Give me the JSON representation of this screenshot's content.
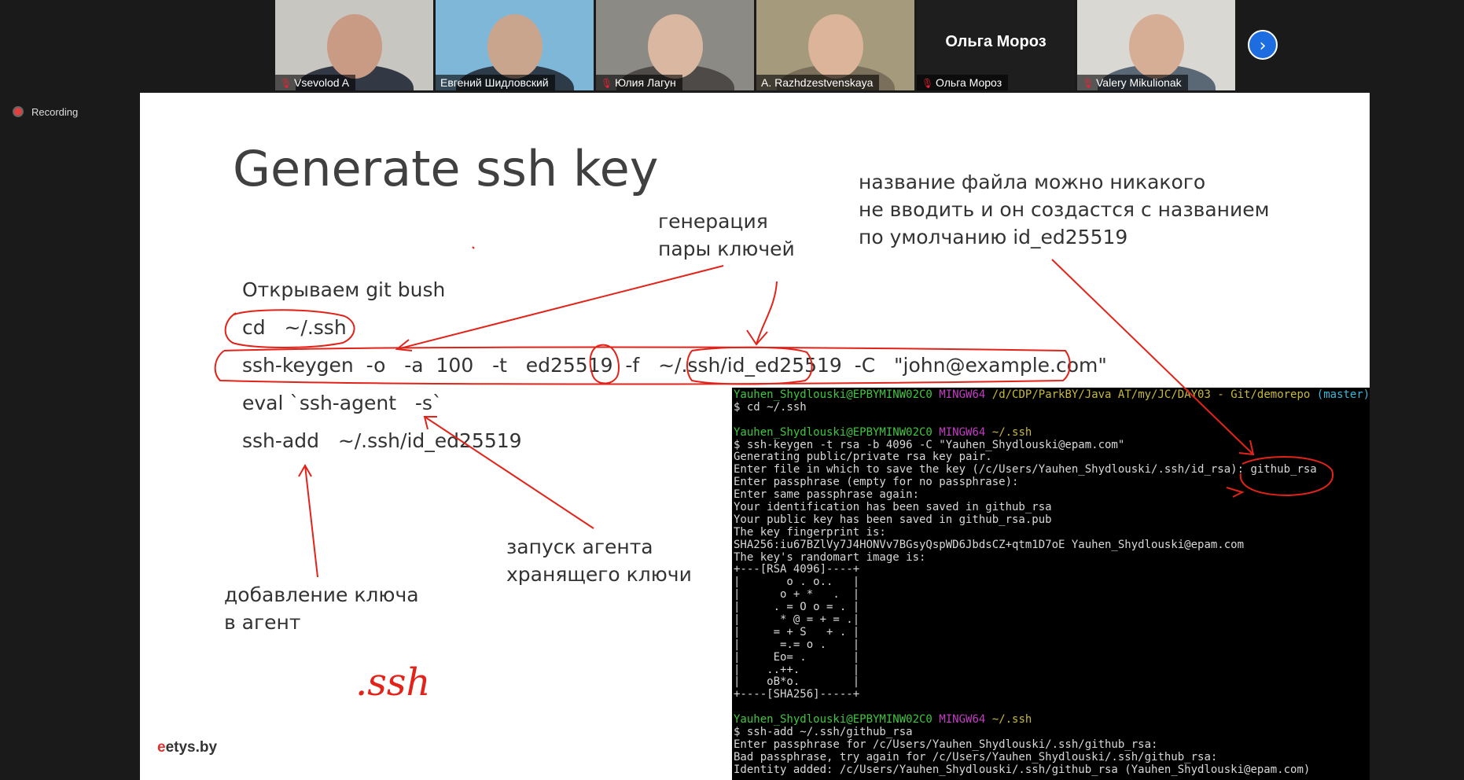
{
  "participants": [
    {
      "name": "Vsevolod A",
      "muted": true,
      "bg": "#c8c6c0",
      "skin": "#c99a84",
      "shirt": "#333944"
    },
    {
      "name": "Евгений Шидловский",
      "muted": false,
      "bg": "#7fb7d9",
      "skin": "#c9a58e",
      "shirt": "#2d3a48"
    },
    {
      "name": "Юлия Лагун",
      "muted": true,
      "bg": "#8c8a84",
      "skin": "#d9b7a0",
      "shirt": "#4d4a48"
    },
    {
      "name": "A. Razhdzestvenskaya",
      "muted": false,
      "bg": "#a69a7d",
      "skin": "#dbb49a",
      "shirt": "#7a6f5a"
    },
    {
      "name": "Ольга Мороз",
      "muted": true,
      "bg": "#1e1e1e"
    },
    {
      "name": "Valery Mikulionak",
      "muted": true,
      "bg": "#dad8d2",
      "skin": "#d6ad95",
      "shirt": "#5a6875"
    }
  ],
  "name_only_tile": "Ольга Мороз",
  "next_button": "›",
  "recording_label": "Recording",
  "slide": {
    "title": "Generate ssh key",
    "annotation_right": [
      "название файла можно никакого",
      "не вводить и он создастся с названием",
      "по умолчанию id_ed25519"
    ],
    "annotation_pair": [
      "генерация",
      "пары ключей"
    ],
    "open_gitbash": "Открываем git bush",
    "cmd_cd": "cd   ~/.ssh",
    "cmd_keygen": "ssh-keygen  -o   -a  100   -t   ed25519  -f   ~/.ssh/id_ed25519  -C   \"john@example.com\"",
    "cmd_eval": "eval `ssh-agent   -s`",
    "cmd_add": "ssh-add   ~/.ssh/id_ed25519",
    "annotation_agent": [
      "запуск агента",
      "хранящего ключи"
    ],
    "annotation_add": [
      "добавление ключа",
      "в агент"
    ],
    "handwritten": ".ssh",
    "logo_mark": "e",
    "logo_text": "etys.by"
  },
  "terminal": {
    "prompt_user": "Yauhen_Shydlouski@EPBYMINW02C0",
    "prompt_env": "MINGW64",
    "prompt_path1": "/d/CDP/ParkBY/Java AT/my/JC/DAY03 - Git/demorepo",
    "prompt_branch": "(master)",
    "prompt_path2": "~/.ssh",
    "lines_a": [
      "$ cd ~/.ssh"
    ],
    "lines_b": [
      "$ ssh-keygen -t rsa -b 4096 -C \"Yauhen_Shydlouski@epam.com\"",
      "Generating public/private rsa key pair.",
      "Enter file in which to save the key (/c/Users/Yauhen_Shydlouski/.ssh/id_rsa): github_rsa",
      "Enter passphrase (empty for no passphrase):",
      "Enter same passphrase again:",
      "Your identification has been saved in github_rsa",
      "Your public key has been saved in github_rsa.pub",
      "The key fingerprint is:",
      "SHA256:iu67BZlVy7J4HONVv7BGsyQspWD6JbdsCZ+qtm1D7oE Yauhen_Shydlouski@epam.com",
      "The key's randomart image is:",
      "+---[RSA 4096]----+",
      "|       o . o..   |",
      "|      o + *   .  |",
      "|     . = O o = . |",
      "|      * @ = + = .|",
      "|     = + S   + . |",
      "|      =.= o .    |",
      "|     Eo= .       |",
      "|    ..++.        |",
      "|    oB*o.        |",
      "+----[SHA256]-----+"
    ],
    "lines_c": [
      "$ ssh-add ~/.ssh/github_rsa",
      "Enter passphrase for /c/Users/Yauhen_Shydlouski/.ssh/github_rsa:",
      "Bad passphrase, try again for /c/Users/Yauhen_Shydlouski/.ssh/github_rsa:",
      "Identity added: /c/Users/Yauhen_Shydlouski/.ssh/github_rsa (Yauhen_Shydlouski@epam.com)"
    ]
  },
  "colors": {
    "annotation_red": "#e2231a",
    "zoom_blue": "#1d6de0"
  }
}
